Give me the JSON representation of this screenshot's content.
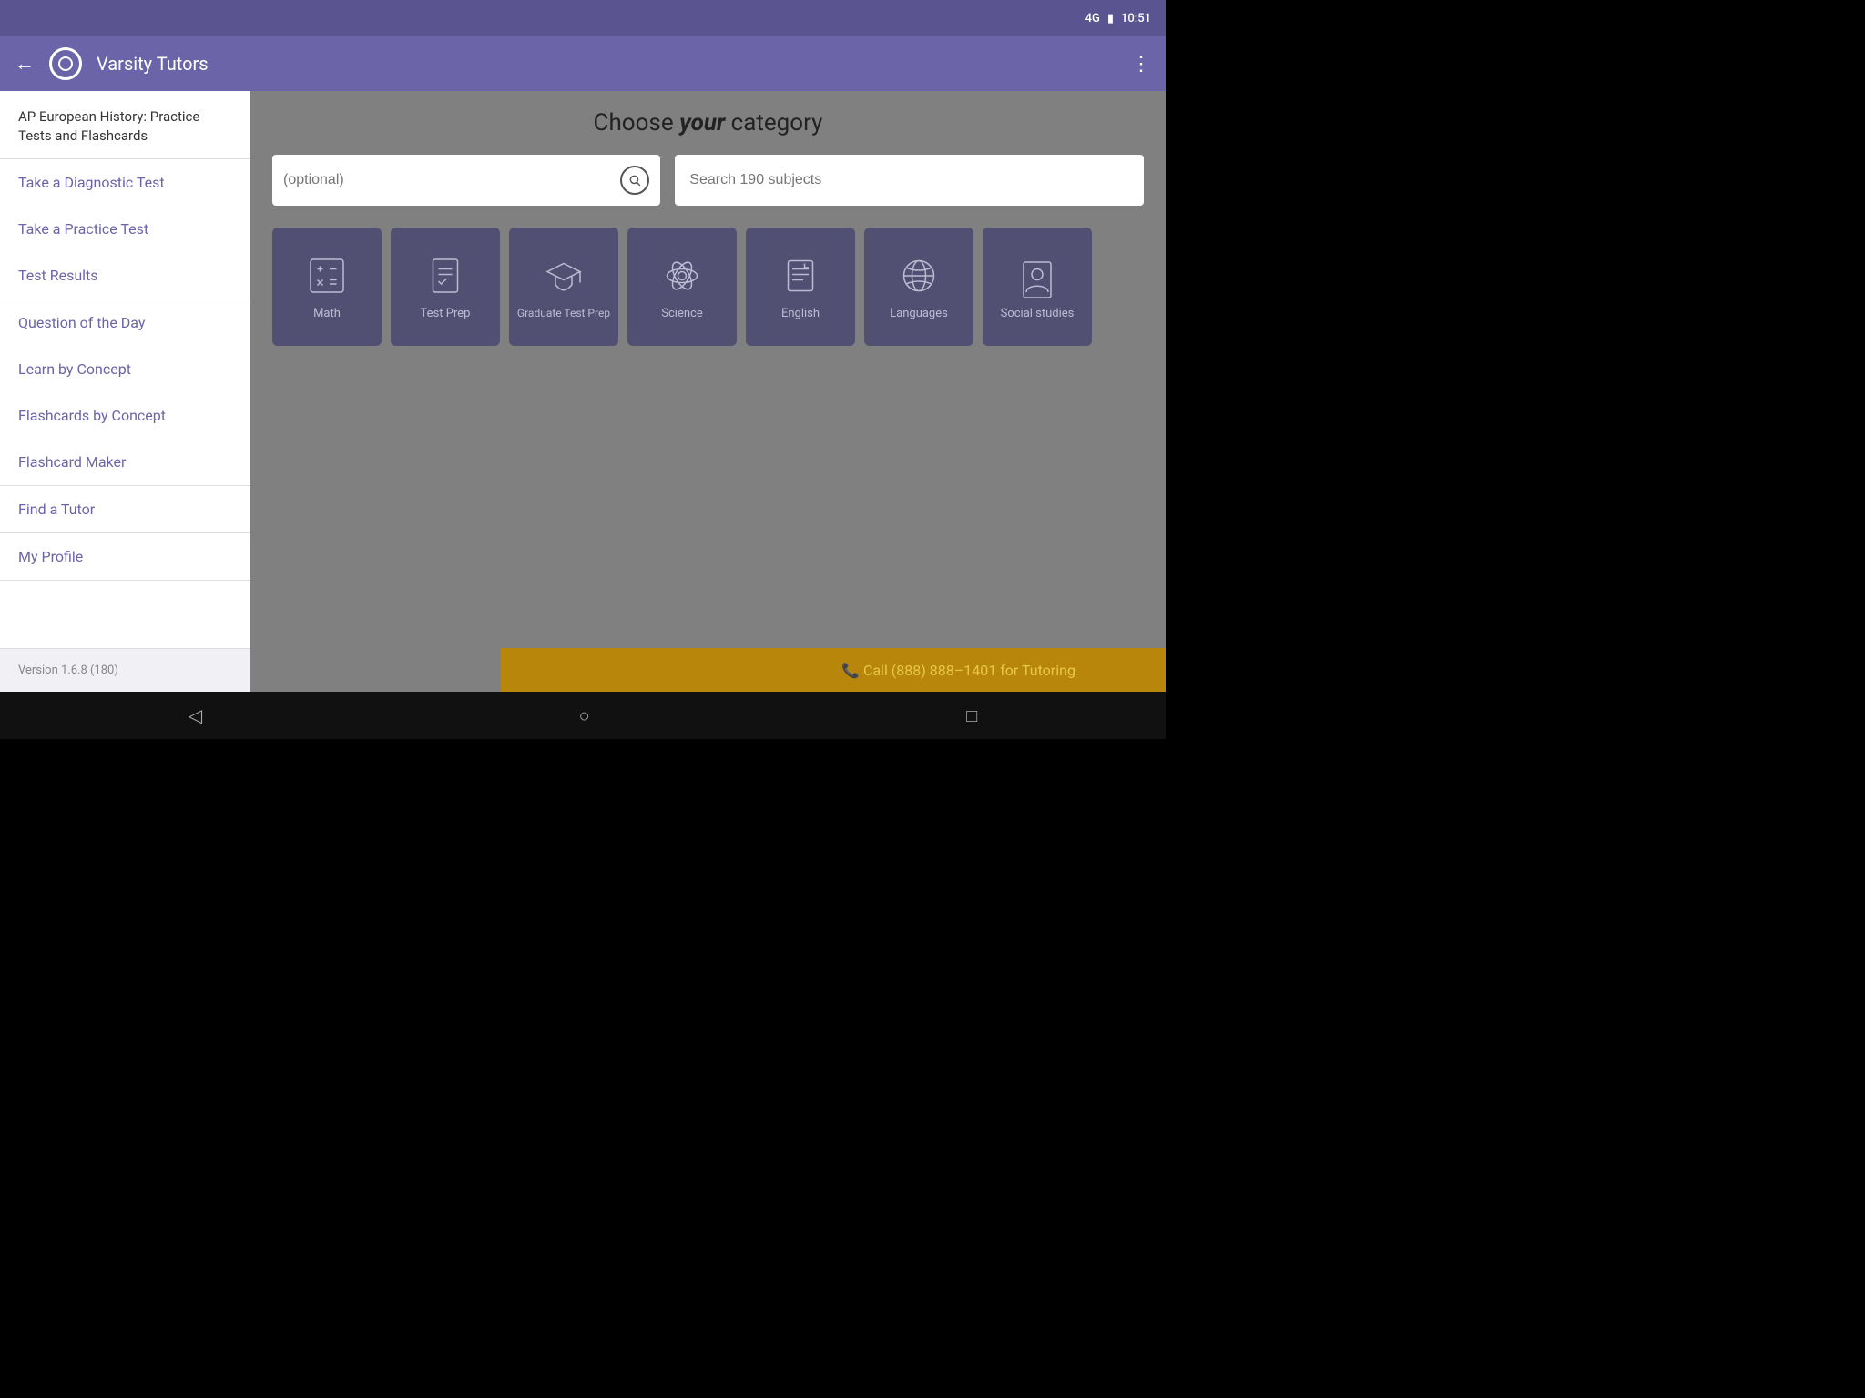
{
  "statusBar": {
    "signal": "4G",
    "battery": "🔋",
    "time": "10:51"
  },
  "appBar": {
    "title": "Varsity Tutors",
    "backLabel": "←",
    "menuLabel": "⋮"
  },
  "sidebar": {
    "header": "AP European History: Practice Tests and Flashcards",
    "sections": [
      {
        "items": [
          "Take a Diagnostic Test",
          "Take a Practice Test",
          "Test Results"
        ]
      },
      {
        "items": [
          "Question of the Day",
          "Learn by Concept",
          "Flashcards by Concept",
          "Flashcard Maker"
        ]
      },
      {
        "items": [
          "Find a Tutor"
        ]
      },
      {
        "items": [
          "My Profile"
        ]
      }
    ],
    "version": "Version 1.6.8 (180)"
  },
  "mainContent": {
    "title": "Choose ",
    "titleItalic": "your",
    "titleEnd": " category",
    "searchLeftPlaceholder": "(optional)",
    "searchRightPlaceholder": "Search 190 subjects",
    "categories": [
      {
        "label": "Math",
        "icon": "math"
      },
      {
        "label": "Test Prep",
        "icon": "testprep"
      },
      {
        "label": "Graduate Test Prep",
        "icon": "gradtestprep"
      },
      {
        "label": "Science",
        "icon": "science"
      },
      {
        "label": "English",
        "icon": "english"
      },
      {
        "label": "Languages",
        "icon": "languages"
      },
      {
        "label": "Social studies",
        "icon": "socialstudies"
      }
    ]
  },
  "callBar": {
    "text": "📞 Call (888) 888–1401 for Tutoring"
  },
  "navBar": {
    "back": "◁",
    "home": "○",
    "recent": "□"
  }
}
